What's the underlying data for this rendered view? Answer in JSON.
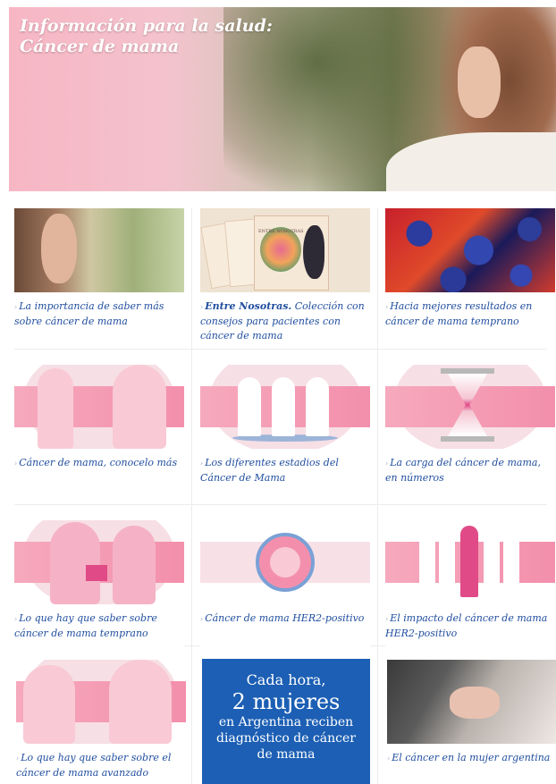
{
  "hero": {
    "title": "Información para la salud:\nCáncer de mama"
  },
  "cards": [
    {
      "id": "saber-mas",
      "caption": "La importancia de saber más sobre cáncer de mama"
    },
    {
      "id": "entre-nosotras",
      "bold": "Entre Nosotras.",
      "caption": " Colección con consejos para pacientes con cáncer de mama"
    },
    {
      "id": "mejores-resultados",
      "caption": "Hacia mejores resultados en cáncer de mama temprano"
    },
    {
      "id": "conocelo",
      "caption": "Cáncer de mama, conocelo más"
    },
    {
      "id": "estadios",
      "caption": "Los diferentes estadios del Cáncer de Mama"
    },
    {
      "id": "carga",
      "caption": "La carga del cáncer de mama, en números"
    },
    {
      "id": "temprano",
      "caption": "Lo que hay que saber sobre cáncer de mama temprano"
    },
    {
      "id": "her2",
      "caption": "Cáncer de mama HER2-positivo"
    },
    {
      "id": "impacto-her2",
      "caption": "El impacto del cáncer de mama HER2-positivo"
    },
    {
      "id": "avanzado",
      "caption": "Lo que hay que saber sobre el cáncer de mama avanzado"
    },
    {
      "id": "mujer-argentina",
      "caption": "El cáncer en la mujer argentina"
    }
  ],
  "book_cover_text": "ENTRE NOSOTRAS",
  "promo": {
    "line1": "Cada hora,",
    "line2": "2 mujeres",
    "line3": "en Argentina reciben",
    "line4": "diagnóstico de cáncer",
    "line5": "de mama"
  },
  "colors": {
    "link": "#1f4d9e",
    "pink": "#f38fac",
    "promo_bg": "#1c5fb4"
  }
}
